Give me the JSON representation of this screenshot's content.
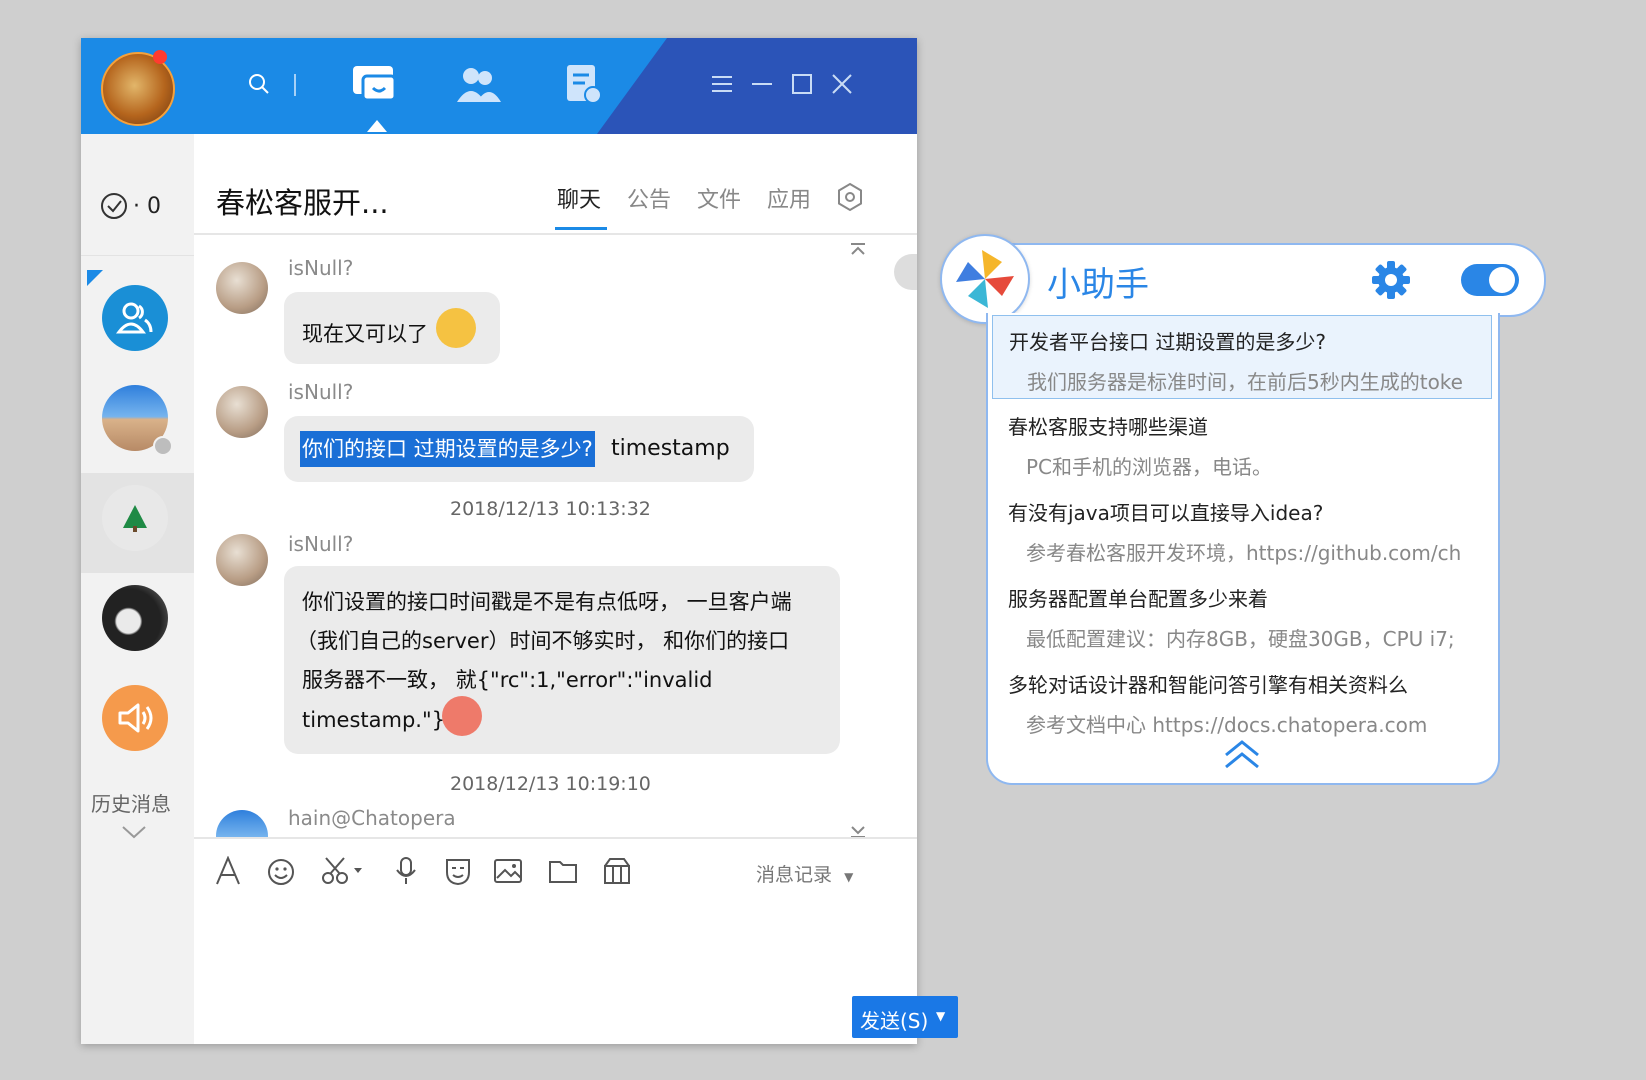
{
  "window": {
    "chat_title": "春松客服开...",
    "task_count": "· 0",
    "tabs": [
      "聊天",
      "公告",
      "文件",
      "应用"
    ],
    "history_label": "历史消息"
  },
  "messages": [
    {
      "nick": "isNull?",
      "text": "现在又可以了"
    },
    {
      "nick": "isNull?",
      "highlighted": "你们的接口 过期设置的是多少?",
      "text": " timestamp"
    },
    {
      "timestamp": "2018/12/13 10:13:32"
    },
    {
      "nick": "isNull?",
      "lines": [
        "你们设置的接口时间戳是不是有点低呀， 一旦客户端",
        "（我们自己的server）时间不够实时， 和你们的接口",
        "服务器不一致， 就{\"rc\":1,\"error\":\"invalid",
        "timestamp.\"}"
      ]
    },
    {
      "timestamp": "2018/12/13 10:19:10"
    },
    {
      "nick": "hain@Chatopera"
    }
  ],
  "toolbar": {
    "history_record": "消息记录",
    "send_label": "发送(S)"
  },
  "assistant": {
    "title": "小助手",
    "items": [
      {
        "q": "开发者平台接口 过期设置的是多少?",
        "a": "我们服务器是标准时间，在前后5秒内生成的toke"
      },
      {
        "q": "春松客服支持哪些渠道",
        "a": "PC和手机的浏览器，电话。"
      },
      {
        "q": "有没有java项目可以直接导入idea?",
        "a": "参考春松客服开发环境，https://github.com/ch"
      },
      {
        "q": "服务器配置单台配置多少来着",
        "a": "最低配置建议：内存8GB，硬盘30GB，CPU i7;"
      },
      {
        "q": "多轮对话设计器和智能问答引擎有相关资料么",
        "a": "参考文档中心 https://docs.chatopera.com"
      }
    ]
  },
  "colors": {
    "brand": "#1b8ae6",
    "accent": "#1a78e6",
    "highlight": "#1a6fd6"
  }
}
